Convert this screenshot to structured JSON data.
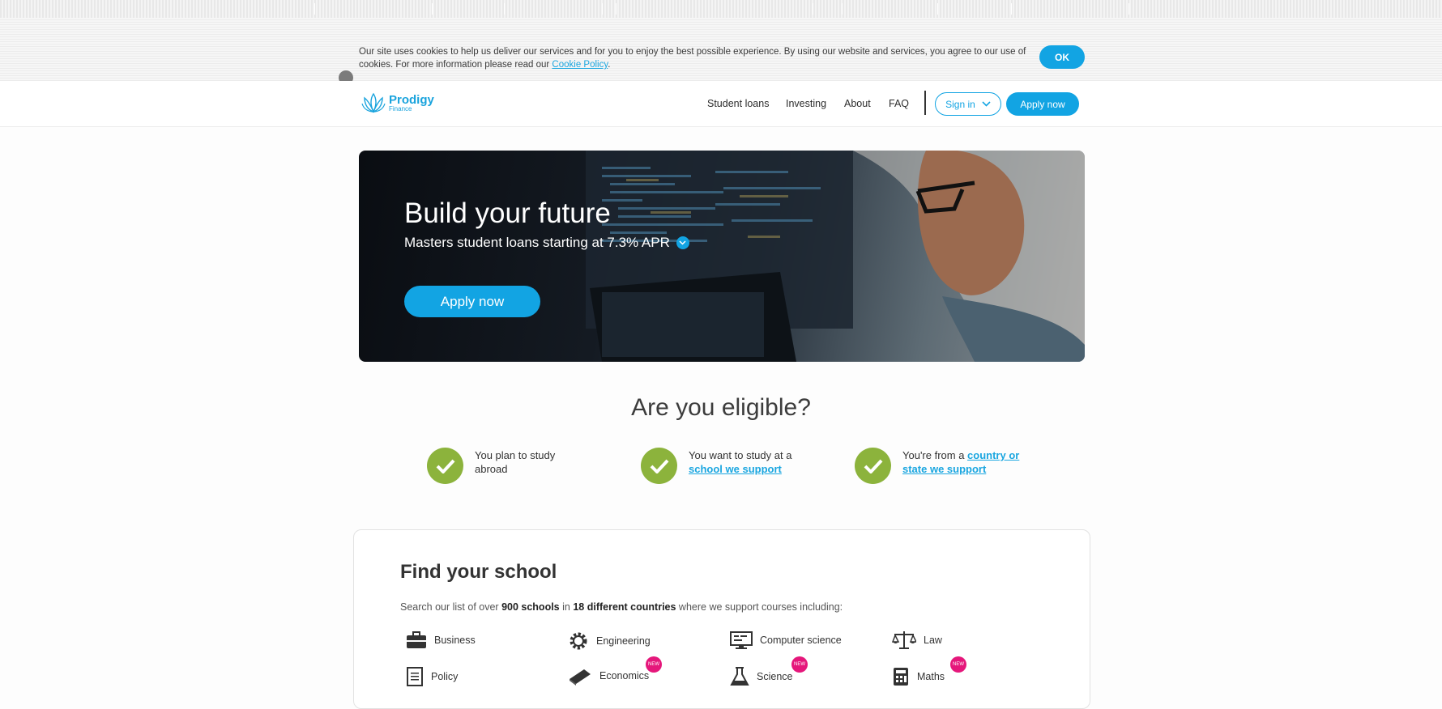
{
  "cookie_banner": {
    "text": "Our site uses cookies to help us deliver our services and for you to enjoy the best possible experience. By using our website and services, you agree to our use of cookies. For more information please read our ",
    "link_label": "Cookie Policy",
    "suffix": ".",
    "ok_label": "OK"
  },
  "brand": {
    "name": "Prodigy",
    "sub": "Finance"
  },
  "nav": {
    "links": [
      "Student loans",
      "Investing",
      "About",
      "FAQ"
    ],
    "signin_label": "Sign in",
    "apply_label": "Apply now"
  },
  "hero": {
    "title": "Build your future",
    "subtitle": "Masters student loans starting at 7.3% APR",
    "button_label": "Apply now"
  },
  "eligibility": {
    "title": "Are you eligible?",
    "items": [
      {
        "text": "You plan to study abroad"
      },
      {
        "text": "You want to study at a ",
        "link": "school we support"
      },
      {
        "text": "You're from a ",
        "link": "country or state we support"
      }
    ]
  },
  "find_school": {
    "title": "Find your school",
    "desc_prefix": "Search our list of over ",
    "schools": "900 schools",
    "desc_mid": " in ",
    "countries": "18 different countries",
    "desc_suffix": " where we support courses including:",
    "categories": [
      {
        "label": "Business",
        "icon": "briefcase-icon"
      },
      {
        "label": "Engineering",
        "icon": "gear-icon"
      },
      {
        "label": "Computer science",
        "icon": "monitor-icon"
      },
      {
        "label": "Law",
        "icon": "scales-icon"
      },
      {
        "label": "Policy",
        "icon": "document-icon"
      },
      {
        "label": "Economics",
        "icon": "book-icon",
        "badge": "NEW"
      },
      {
        "label": "Science",
        "icon": "flask-icon",
        "badge": "NEW"
      },
      {
        "label": "Maths",
        "icon": "calculator-icon",
        "badge": "NEW"
      }
    ]
  },
  "colors": {
    "accent": "#12a4e3",
    "check": "#8cb33c",
    "badge": "#e5177b"
  }
}
